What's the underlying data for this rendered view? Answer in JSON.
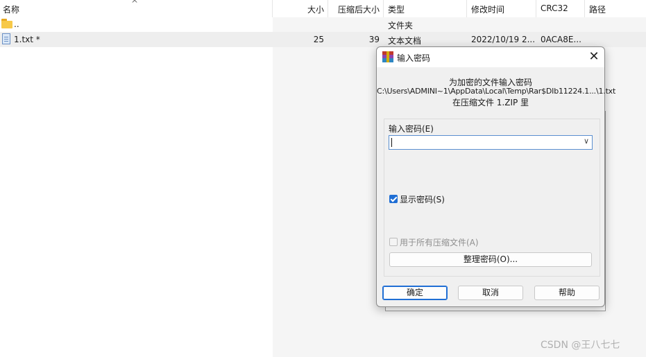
{
  "columns": {
    "name": "名称",
    "size": "大小",
    "packed": "压缩后大小",
    "type": "类型",
    "modified": "修改时间",
    "crc": "CRC32",
    "path": "路径"
  },
  "rows": [
    {
      "name": "..",
      "size": "",
      "packed": "",
      "type": "文件夹",
      "modified": "",
      "crc": "",
      "icon": "folder-icon"
    },
    {
      "name": "1.txt *",
      "size": "25",
      "packed": "39",
      "type": "文本文档",
      "modified": "2022/10/19 2...",
      "crc": "0ACA8E...",
      "icon": "text-file-icon"
    }
  ],
  "dialog": {
    "title": "输入密码",
    "close": "✕",
    "line1": "为加密的文件输入密码",
    "line2": "C:\\Users\\ADMINI~1\\AppData\\Local\\Temp\\Rar$DIb11224.1...\\1.txt",
    "line3": "在压缩文件 1.ZIP 里",
    "password_label": "输入密码(E)",
    "password_value": "",
    "show_password_label": "显示密码(S)",
    "show_password_checked": true,
    "use_for_all_label": "用于所有压缩文件(A)",
    "use_for_all_checked": false,
    "organize_button": "整理密码(O)...",
    "ok_button": "确定",
    "cancel_button": "取消",
    "help_button": "帮助",
    "combo_arrow": "∨"
  },
  "sort_indicator": "^",
  "watermark": "CSDN @王八七七",
  "colors": {
    "accent": "#1f6ed4",
    "folder": "#f7c948",
    "selected_row": "#eeeeee"
  }
}
